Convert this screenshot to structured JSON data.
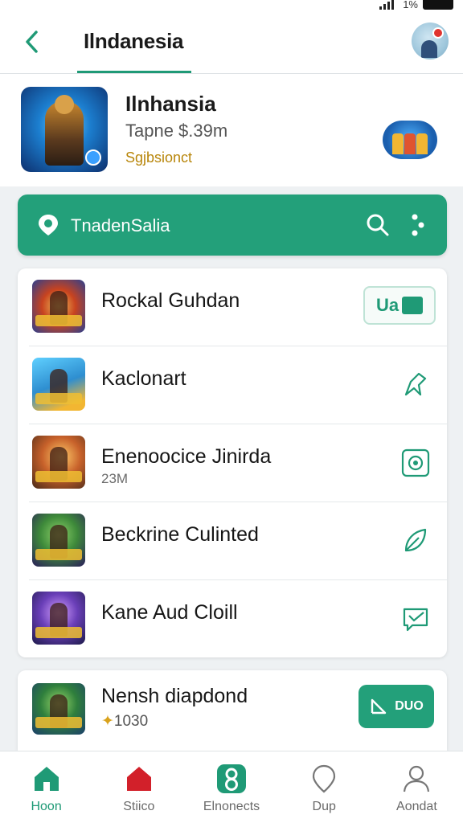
{
  "status_bar": {
    "battery_text": "1%"
  },
  "header": {
    "title": "Ilndanesia"
  },
  "featured": {
    "title": "Ilnhansia",
    "subtitle": "Tapne $.39m",
    "tag": "Sgjbsionct"
  },
  "search_bar": {
    "label": "TnadenSalia"
  },
  "list": {
    "items": [
      {
        "name": "Rockal Guhdan",
        "meta": "",
        "action": "pill",
        "pill_text": "Ua"
      },
      {
        "name": "Kaclonart",
        "meta": "",
        "action": "pencil-icon"
      },
      {
        "name": "Enenoocice Jinirda",
        "meta": "23M",
        "action": "camera-icon"
      },
      {
        "name": "Beckrine Culinted",
        "meta": "",
        "action": "leaf-icon"
      },
      {
        "name": "Kane Aud Cloill",
        "meta": "",
        "action": "message-icon"
      }
    ]
  },
  "bottom_item": {
    "name": "Nensh diapdond",
    "coin": "✦",
    "meta": "1030",
    "cta_text": "DUO"
  },
  "tabs": [
    {
      "label": "Hoon",
      "icon": "home-icon",
      "active": true
    },
    {
      "label": "Stiico",
      "icon": "shop-icon",
      "active": false
    },
    {
      "label": "Elnonects",
      "icon": "games-icon",
      "active": false
    },
    {
      "label": "Dup",
      "icon": "location-icon",
      "active": false
    },
    {
      "label": "Aondat",
      "icon": "profile-icon",
      "active": false
    }
  ],
  "colors": {
    "accent": "#23a07a",
    "accent_dark": "#1f9a76",
    "tag": "#b8860b"
  }
}
